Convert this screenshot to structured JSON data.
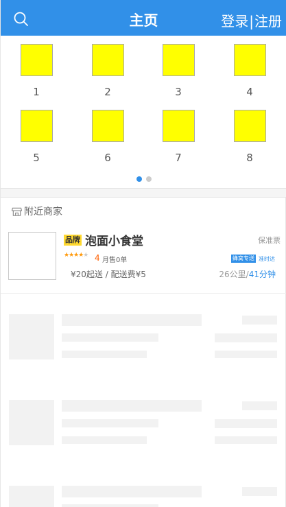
{
  "header": {
    "title": "主页",
    "login_label": "登录",
    "separator": "|",
    "register_label": "注册",
    "color": "#3190e8"
  },
  "categories": [
    {
      "label": "1"
    },
    {
      "label": "2"
    },
    {
      "label": "3"
    },
    {
      "label": "4"
    },
    {
      "label": "5"
    },
    {
      "label": "6"
    },
    {
      "label": "7"
    },
    {
      "label": "8"
    }
  ],
  "carousel": {
    "page": 1,
    "pages": 2
  },
  "nearby": {
    "heading": "附近商家",
    "shop": {
      "brand_tag": "品牌",
      "name": "泡面小食堂",
      "guarantee": "保准票",
      "rating": "4",
      "rating_value": 4,
      "sales": "月售0单",
      "delivery_badge": "蜂窝专送",
      "ontime": "准时达",
      "fees": "¥20起送 / 配送费¥5",
      "distance": "26公里",
      "dist_sep": "/",
      "time": "41分钟"
    }
  },
  "colors": {
    "accent": "#3190e8",
    "category_tile": "#ffff00",
    "brand_tag": "#ffd930",
    "rating": "#ff6000"
  }
}
